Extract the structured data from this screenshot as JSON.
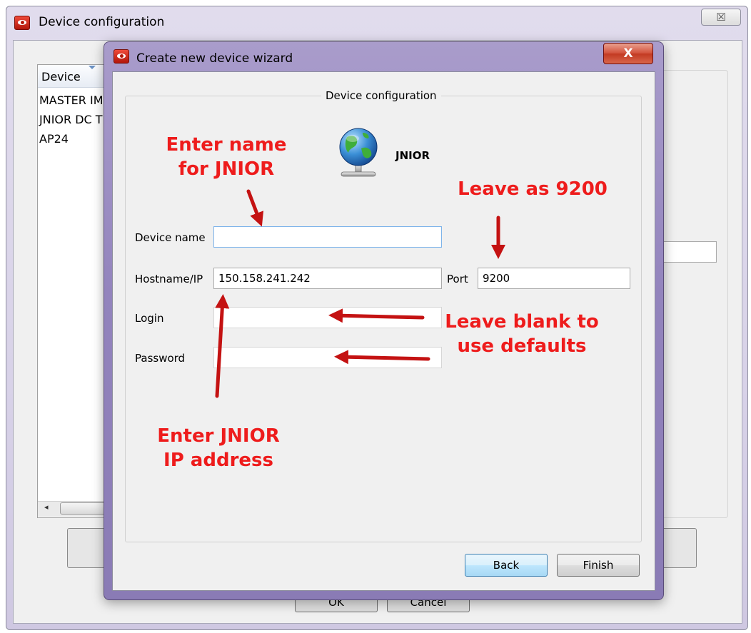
{
  "outer_window": {
    "title": "Device configuration",
    "close_glyph": "☒",
    "device_list": {
      "header": "Device",
      "rows": [
        "MASTER IM",
        "JNIOR DC T",
        "AP24"
      ]
    },
    "ok_label": "OK",
    "cancel_label": "Cancel"
  },
  "wizard": {
    "title": "Create new device wizard",
    "close_glyph": "X",
    "group_title": "Device configuration",
    "device_type": "JNIOR",
    "fields": {
      "device_name": {
        "label": "Device name",
        "value": ""
      },
      "hostname": {
        "label": "Hostname/IP",
        "value": "150.158.241.242"
      },
      "port": {
        "label": "Port",
        "value": "9200"
      },
      "login": {
        "label": "Login",
        "value": ""
      },
      "password": {
        "label": "Password",
        "value": ""
      }
    },
    "back_label": "Back",
    "finish_label": "Finish"
  },
  "annotations": {
    "name": [
      "Enter name",
      "for JNIOR"
    ],
    "port": [
      "Leave as 9200"
    ],
    "login": [
      "Leave blank to",
      "use defaults"
    ],
    "ip": [
      "Enter JNIOR",
      "IP address"
    ],
    "color": "#ee1c1c"
  },
  "icons": {
    "app": "app-logo-icon",
    "device": "globe-network-icon",
    "sort": "sort-arrow-icon"
  }
}
